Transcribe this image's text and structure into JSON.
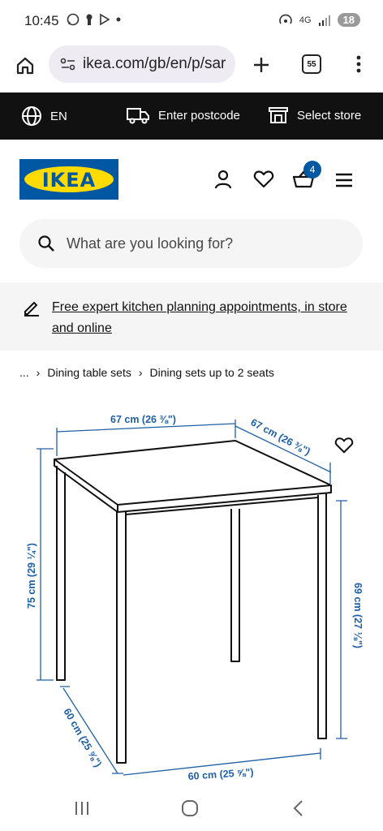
{
  "status": {
    "time": "10:45",
    "network": "4G",
    "battery": "18"
  },
  "browser": {
    "url": "ikea.com/gb/en/p/sar",
    "tab_count": "55"
  },
  "topbar": {
    "language": "EN",
    "postcode": "Enter postcode",
    "store": "Select store"
  },
  "header": {
    "logo": "IKEA",
    "basket_count": "4"
  },
  "search": {
    "placeholder": "What are you looking for?"
  },
  "banner": {
    "text": "Free expert kitchen planning appointments, in store and online"
  },
  "breadcrumb": {
    "ellipsis": "...",
    "items": [
      "Dining table sets",
      "Dining sets up to 2 seats"
    ]
  },
  "dimensions": {
    "top_width": "67 cm (26 ⅜\")",
    "top_depth": "67 cm (26 ⅜\")",
    "total_height": "75 cm (29 ¼\")",
    "under_height": "69 cm (27 ⅛\")",
    "base_depth": "60 cm (25 ⅝\")",
    "base_width": "60 cm (25 ⅝\")"
  },
  "colors": {
    "ikea_blue": "#0058a3",
    "ikea_yellow": "#ffdb00",
    "dimension_blue": "#1f5fa6"
  }
}
